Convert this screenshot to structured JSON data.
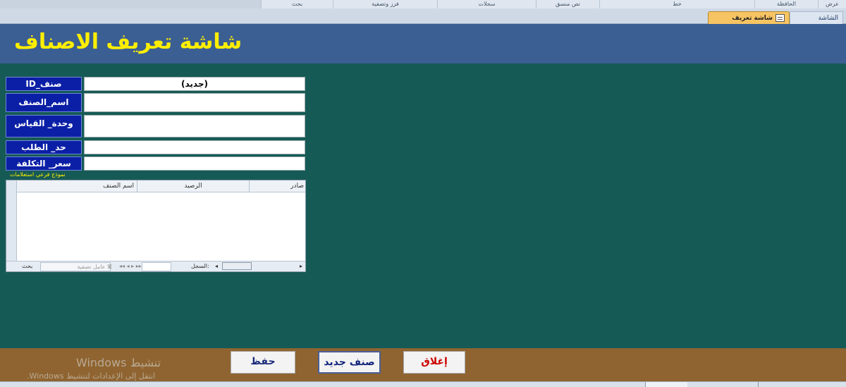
{
  "ribbon": {
    "groups": [
      "عرض",
      "الحافظة",
      "خط",
      "نص منسق",
      "سجلات",
      "فرز وتصفية",
      "بحث"
    ]
  },
  "tabs": {
    "home": "الشاشة الرئيسية",
    "active": "شاشة تعريف الاصناف"
  },
  "form": {
    "title": "شاشة تعريف الاصناف",
    "fields": [
      {
        "label": "صنف_ID",
        "value": "(جديد)"
      },
      {
        "label": "اسم_الصنف",
        "value": ""
      },
      {
        "label": "وحدة_ القياس",
        "value": ""
      },
      {
        "label": "حد_ الطلب",
        "value": ""
      },
      {
        "label": "سعر_ التكلفة",
        "value": ""
      }
    ],
    "subform_caption": "نموذج فرعي استعلامات",
    "subform": {
      "columns": [
        "صادر",
        "الرصيد",
        "اسم الصنف"
      ],
      "nav": {
        "record_label": "السجل:",
        "filter_label": "بلا عامل تصفية",
        "search_label": "بحث"
      }
    }
  },
  "buttons": {
    "close": "إغلاق",
    "new_item": "صنف جديد",
    "save": "حفظ"
  },
  "watermark": {
    "line1": "تنشيط Windows",
    "line2": "انتقل إلى الإعدادات لتنشيط Windows."
  },
  "colors": {
    "form_bg": "#165a56",
    "header_bg": "#3b5f93",
    "title": "#ffee00",
    "label_bg": "#0b1fa6",
    "footer_bg": "#8f6430",
    "close_text": "#cc0000"
  }
}
